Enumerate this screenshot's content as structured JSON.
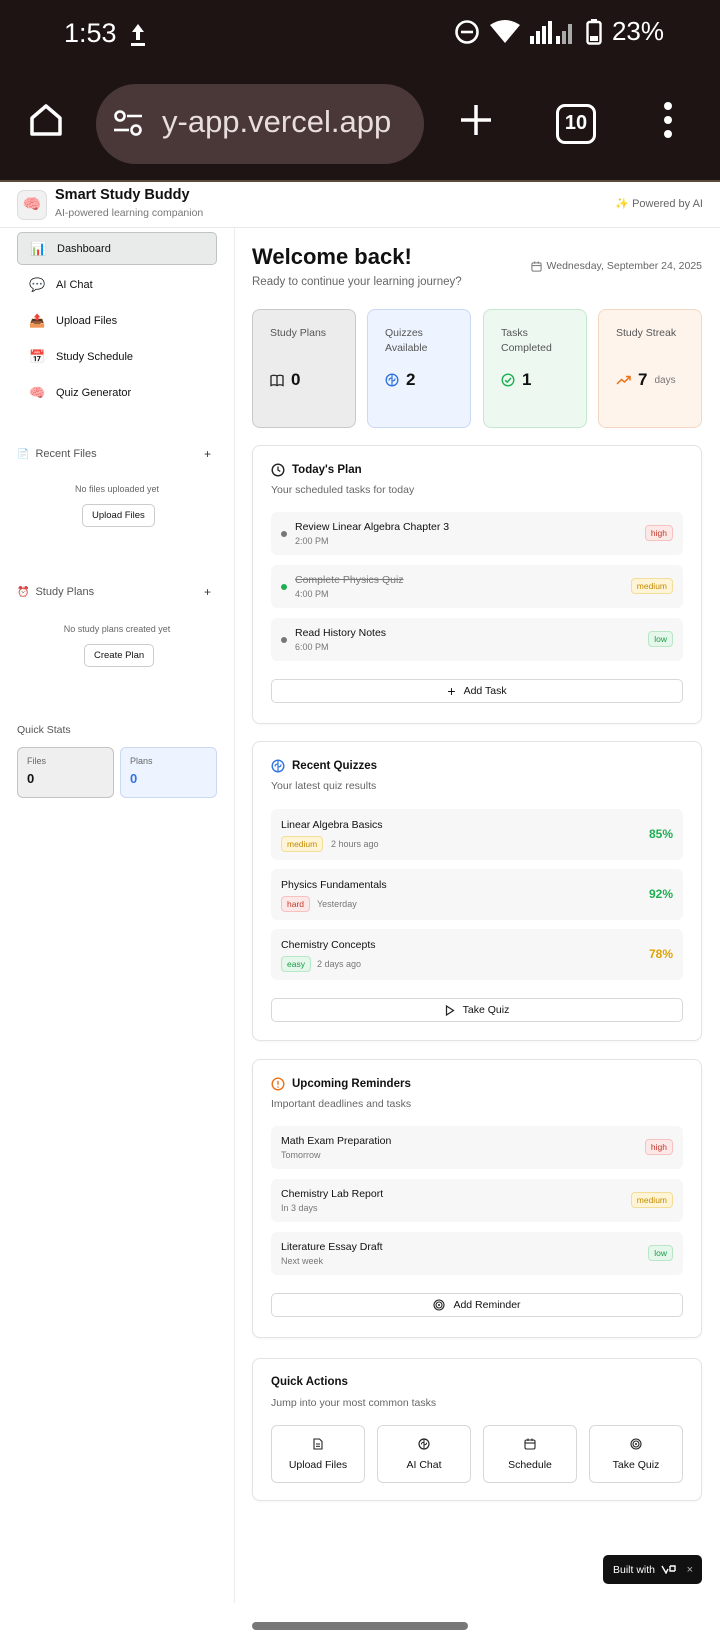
{
  "status": {
    "time": "1:53",
    "battery": "23%"
  },
  "browser": {
    "url": "y-app.vercel.app",
    "tab_count": "10"
  },
  "header": {
    "title": "Smart Study Buddy",
    "subtitle": "AI-powered learning companion",
    "powered": "Powered by AI"
  },
  "sidebar": {
    "nav": [
      {
        "label": "Dashboard",
        "icon": "bar-chart-icon",
        "active": true
      },
      {
        "label": "AI Chat",
        "icon": "speech-bubble-icon"
      },
      {
        "label": "Upload Files",
        "icon": "outbox-tray-icon"
      },
      {
        "label": "Study Schedule",
        "icon": "calendar-icon"
      },
      {
        "label": "Quiz Generator",
        "icon": "brain-icon"
      }
    ],
    "recent_files": {
      "title": "Recent Files",
      "empty": "No files uploaded yet",
      "button": "Upload Files"
    },
    "study_plans": {
      "title": "Study Plans",
      "empty": "No study plans created yet",
      "button": "Create Plan"
    },
    "quick_stats": {
      "title": "Quick Stats",
      "files_label": "Files",
      "files_value": "0",
      "plans_label": "Plans",
      "plans_value": "0"
    }
  },
  "main": {
    "welcome": "Welcome back!",
    "subtitle": "Ready to continue your learning journey?",
    "date": "Wednesday, September 24, 2025",
    "stats": [
      {
        "label": "Study Plans",
        "value": "0",
        "unit": "",
        "icon": "book-icon",
        "bg": "#ececec",
        "border": "#c9c9c9"
      },
      {
        "label": "Quizzes Available",
        "value": "2",
        "unit": "",
        "icon": "brain-icon",
        "bg": "#eef4ff",
        "border": "#c9d8f3"
      },
      {
        "label": "Tasks Completed",
        "value": "1",
        "unit": "",
        "icon": "check-circle-icon",
        "bg": "#edf9f0",
        "border": "#c4e8cf"
      },
      {
        "label": "Study Streak",
        "value": "7",
        "unit": "days",
        "icon": "trending-up-icon",
        "bg": "#fff4ec",
        "border": "#f4d6c1"
      }
    ],
    "todays_plan": {
      "title": "Today's Plan",
      "subtitle": "Your scheduled tasks for today",
      "tasks": [
        {
          "title": "Review Linear Algebra Chapter 3",
          "time": "2:00 PM",
          "priority": "high",
          "done": false
        },
        {
          "title": "Complete Physics Quiz",
          "time": "4:00 PM",
          "priority": "medium",
          "done": true
        },
        {
          "title": "Read History Notes",
          "time": "6:00 PM",
          "priority": "low",
          "done": false
        }
      ],
      "button": "Add Task"
    },
    "recent_quizzes": {
      "title": "Recent Quizzes",
      "subtitle": "Your latest quiz results",
      "quizzes": [
        {
          "title": "Linear Algebra Basics",
          "difficulty": "medium",
          "when": "2 hours ago",
          "score": "85%",
          "color": "#1fae52"
        },
        {
          "title": "Physics Fundamentals",
          "difficulty": "hard",
          "when": "Yesterday",
          "score": "92%",
          "color": "#1fae52"
        },
        {
          "title": "Chemistry Concepts",
          "difficulty": "easy",
          "when": "2 days ago",
          "score": "78%",
          "color": "#e0a400"
        }
      ],
      "button": "Take Quiz"
    },
    "reminders": {
      "title": "Upcoming Reminders",
      "subtitle": "Important deadlines and tasks",
      "items": [
        {
          "title": "Math Exam Preparation",
          "when": "Tomorrow",
          "priority": "high"
        },
        {
          "title": "Chemistry Lab Report",
          "when": "In 3 days",
          "priority": "medium"
        },
        {
          "title": "Literature Essay Draft",
          "when": "Next week",
          "priority": "low"
        }
      ],
      "button": "Add Reminder"
    },
    "quick_actions": {
      "title": "Quick Actions",
      "subtitle": "Jump into your most common tasks",
      "actions": [
        {
          "label": "Upload Files",
          "icon": "file-icon"
        },
        {
          "label": "AI Chat",
          "icon": "brain-icon"
        },
        {
          "label": "Schedule",
          "icon": "calendar-icon"
        },
        {
          "label": "Take Quiz",
          "icon": "target-icon"
        }
      ]
    }
  },
  "built_with": "Built with"
}
